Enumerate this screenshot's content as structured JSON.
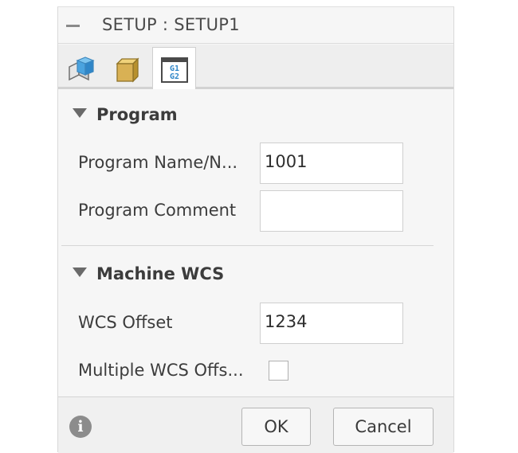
{
  "dialog": {
    "title": "SETUP : SETUP1",
    "tabs": [
      {
        "icon": "setup-cube-icon"
      },
      {
        "icon": "stock-box-icon"
      },
      {
        "icon": "post-process-g1g2-icon",
        "text_top": "G1",
        "text_bottom": "G2",
        "active": true
      }
    ]
  },
  "program": {
    "section_title": "Program",
    "name_label": "Program Name/N...",
    "name_value": "1001",
    "comment_label": "Program Comment",
    "comment_value": ""
  },
  "machine_wcs": {
    "section_title": "Machine WCS",
    "offset_label": "WCS Offset",
    "offset_value": "1234",
    "multiple_label": "Multiple WCS Offs...",
    "multiple_checked": false
  },
  "footer": {
    "ok_label": "OK",
    "cancel_label": "Cancel"
  },
  "colors": {
    "panel_bg": "#f6f6f6",
    "icon_blue": "#4aa3df",
    "icon_gold": "#d9b154"
  }
}
